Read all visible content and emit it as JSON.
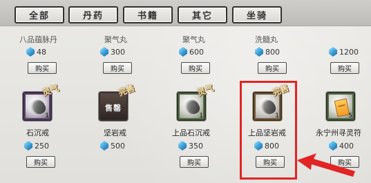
{
  "tabs": [
    {
      "label": "全部"
    },
    {
      "label": "丹药"
    },
    {
      "label": "书籍"
    },
    {
      "label": "其它"
    },
    {
      "label": "坐骑"
    }
  ],
  "top_row": [
    {
      "name": "八品蕴脉丹",
      "price": "48",
      "buy": "购买"
    },
    {
      "name": "聚气丸",
      "price": "300",
      "buy": "购买"
    },
    {
      "name": "聚气丸",
      "price": "600",
      "buy": "购买"
    },
    {
      "name": "洗髓丸",
      "price": "800",
      "buy": "购买"
    },
    {
      "name": "",
      "price": "1200",
      "buy": "购买"
    }
  ],
  "items": [
    {
      "name": "石沉戒",
      "price": "250",
      "buy": "购买",
      "count": "1",
      "badge": "灵气",
      "sold": ""
    },
    {
      "name": "坚岩戒",
      "price": "500",
      "buy": "购买",
      "count": "",
      "badge": "完售",
      "sold": "售罄"
    },
    {
      "name": "上品石沉戒",
      "price": "350",
      "buy": "购买",
      "count": "1",
      "badge": "灵气",
      "sold": ""
    },
    {
      "name": "上品坚岩戒",
      "price": "800",
      "buy": "购买",
      "count": "1",
      "badge": "完售",
      "sold": ""
    },
    {
      "name": "永宁州寻灵符",
      "price": "400",
      "buy": "购买",
      "count": "5",
      "badge": "",
      "sold": ""
    }
  ],
  "colors": {
    "highlight": "#e12424",
    "gem": "#3fa4dc"
  }
}
